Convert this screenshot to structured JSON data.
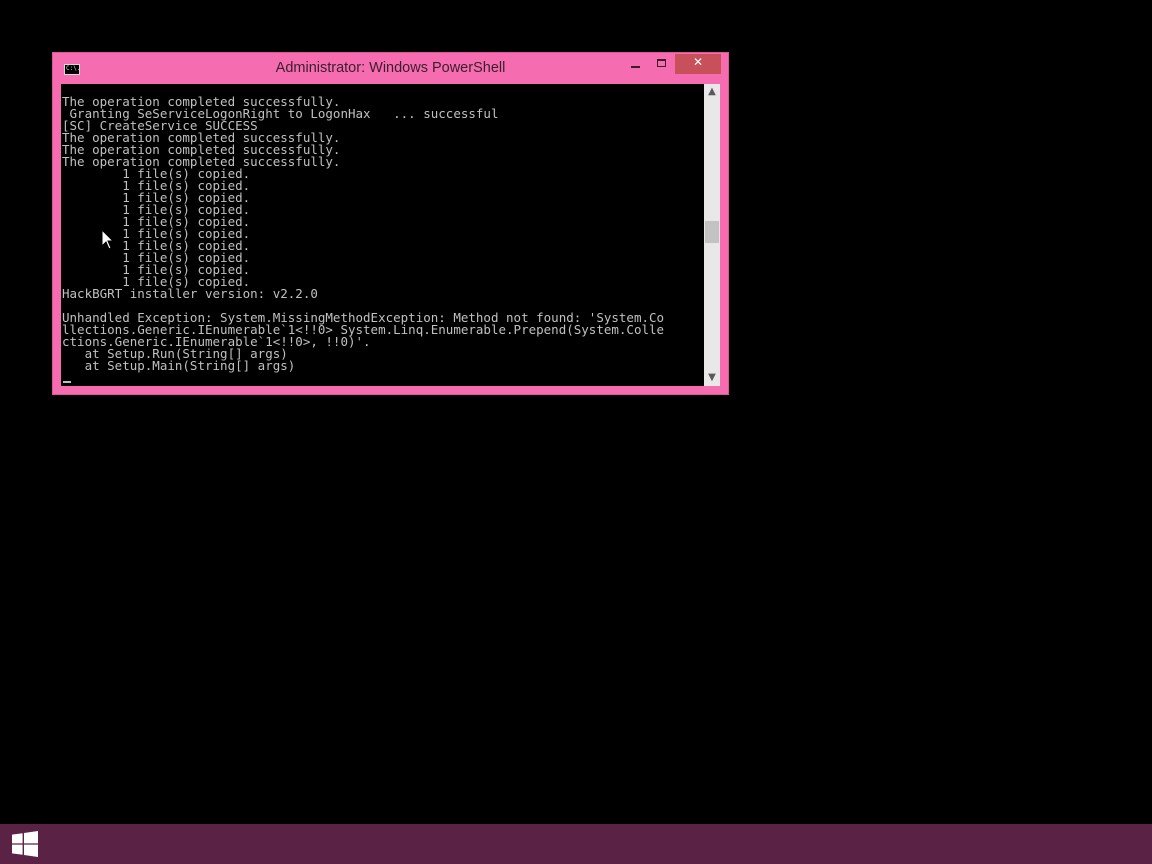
{
  "window": {
    "title": "Administrator: Windows PowerShell",
    "icon": "console-icon",
    "icon_glyph": "C:\\.",
    "minimize_glyph": "minimize-icon",
    "maximize_glyph": "maximize-icon",
    "close_glyph": "✕"
  },
  "console": {
    "lines": [
      "The operation completed successfully.",
      " Granting SeServiceLogonRight to LogonHax   ... successful",
      "[SC] CreateService SUCCESS",
      "The operation completed successfully.",
      "The operation completed successfully.",
      "The operation completed successfully.",
      "        1 file(s) copied.",
      "        1 file(s) copied.",
      "        1 file(s) copied.",
      "        1 file(s) copied.",
      "        1 file(s) copied.",
      "        1 file(s) copied.",
      "        1 file(s) copied.",
      "        1 file(s) copied.",
      "        1 file(s) copied.",
      "        1 file(s) copied.",
      "HackBGRT installer version: v2.2.0",
      "",
      "Unhandled Exception: System.MissingMethodException: Method not found: 'System.Co",
      "llections.Generic.IEnumerable`1<!!0> System.Linq.Enumerable.Prepend(System.Colle",
      "ctions.Generic.IEnumerable`1<!!0>, !!0)'.",
      "   at Setup.Run(String[] args)",
      "   at Setup.Main(String[] args)"
    ]
  },
  "scrollbar": {
    "up_arrow": "▲",
    "down_arrow": "▼",
    "position_fraction": 0.5
  },
  "taskbar": {
    "start_icon": "windows-logo-icon"
  },
  "colors": {
    "window_frame": "#f56db0",
    "close_button": "#c7505a",
    "console_bg": "#000000",
    "console_text": "#c0c0c0",
    "taskbar": "#5a2346",
    "desktop": "#000000"
  }
}
